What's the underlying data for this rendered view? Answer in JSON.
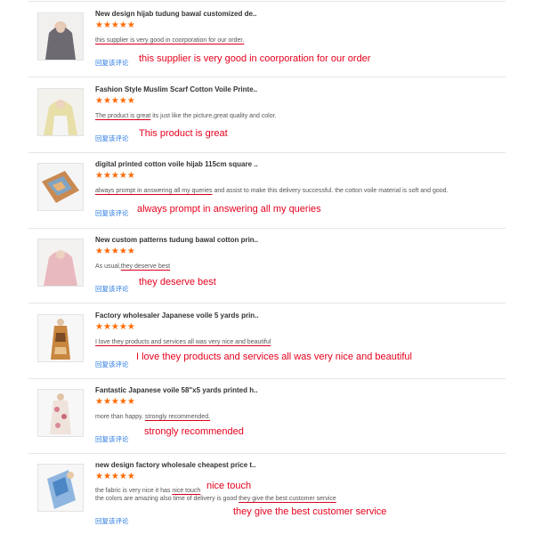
{
  "reviews": [
    {
      "title": "New design hijab tudung bawal customized de..",
      "stars": "★★★★★",
      "comment_pre": "",
      "comment_hl": "this supplier is very good in coorporation for our order.",
      "comment_post": "",
      "reply": "回复该评论",
      "annotation": "this supplier is very good in coorporation for our order"
    },
    {
      "title": "Fashion Style Muslim Scarf Cotton Voile Printe..",
      "stars": "★★★★★",
      "comment_pre": "",
      "comment_hl": "The product is great",
      "comment_post": " its just like the picture,great quality and color.",
      "reply": "回复该评论",
      "annotation": "This product is great"
    },
    {
      "title": "digital printed cotton voile hijab 115cm square ..",
      "stars": "★★★★★",
      "comment_pre": "",
      "comment_hl": "always prompt in answering all my queries",
      "comment_post": " and assist to make this delivery successful.   the cotton voile material is soft and good.",
      "reply": "回复该评论",
      "annotation": "always prompt in answering all my queries"
    },
    {
      "title": "New custom patterns tudung bawal cotton prin..",
      "stars": "★★★★★",
      "comment_pre": "As usual,",
      "comment_hl": "they deserve best",
      "comment_post": "",
      "reply": "回复该评论",
      "annotation": "they deserve best"
    },
    {
      "title": "Factory wholesaler Japanese voile 5 yards prin..",
      "stars": "★★★★★",
      "comment_pre": "",
      "comment_hl": "I love they products and services all was very nice and beautiful",
      "comment_post": "",
      "reply": "回复该评论",
      "annotation": "I love they products and services all was very nice and beautiful"
    },
    {
      "title": "Fantastic Japanese voile 58\"x5 yards printed h..",
      "stars": "★★★★★",
      "comment_pre": "more than happy. ",
      "comment_hl": "strongly recommended.",
      "comment_post": "",
      "reply": "回复该评论",
      "annotation": "strongly recommended"
    },
    {
      "title": "new design factory wholesale cheapest price t..",
      "stars": "★★★★★",
      "comment_pre": "the fabric is very nice it has ",
      "comment_hl": "nice touch",
      "comment_post": "",
      "comment2_pre": "the colors are amazing also time of delivery is good ",
      "comment2_hl": "they give the best customer service",
      "reply": "回复该评论",
      "annotation": "nice touch",
      "annotation2": "they give the best customer service"
    }
  ],
  "colors": {
    "star": "#ff6a00",
    "annotation": "#e5001c",
    "reply_link": "#2a7ae2"
  }
}
